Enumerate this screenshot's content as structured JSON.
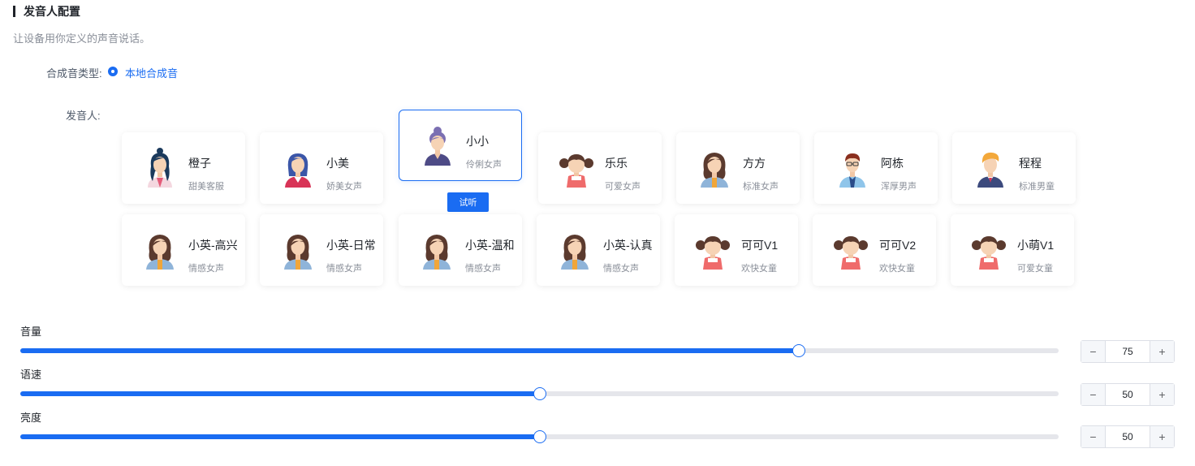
{
  "header": {
    "title": "发音人配置",
    "subtitle": "让设备用你定义的声音说话。"
  },
  "synth_type": {
    "label": "合成音类型:",
    "selected": "本地合成音"
  },
  "speaker": {
    "label": "发音人:",
    "selected": "小小",
    "listen_label": "试听"
  },
  "voices": [
    {
      "name": "橙子",
      "desc": "甜美客服",
      "avatar": "woman-bun-teal-avatar"
    },
    {
      "name": "小美",
      "desc": "娇美女声",
      "avatar": "woman-blue-hair-avatar"
    },
    {
      "name": "小小",
      "desc": "伶俐女声",
      "avatar": "woman-purple-bun-avatar"
    },
    {
      "name": "乐乐",
      "desc": "可爱女声",
      "avatar": "girl-pigtails-avatar"
    },
    {
      "name": "方方",
      "desc": "标准女声",
      "avatar": "woman-brown-hair-avatar"
    },
    {
      "name": "阿栋",
      "desc": "浑厚男声",
      "avatar": "man-glasses-avatar"
    },
    {
      "name": "程程",
      "desc": "标准男童",
      "avatar": "boy-blonde-avatar"
    },
    {
      "name": "小英-高兴",
      "desc": "情感女声",
      "avatar": "woman-brown-hair-avatar"
    },
    {
      "name": "小英-日常",
      "desc": "情感女声",
      "avatar": "woman-brown-hair-avatar"
    },
    {
      "name": "小英-温和",
      "desc": "情感女声",
      "avatar": "woman-brown-hair-avatar"
    },
    {
      "name": "小英-认真",
      "desc": "情感女声",
      "avatar": "woman-brown-hair-avatar"
    },
    {
      "name": "可可V1",
      "desc": "欢快女童",
      "avatar": "girl-pigtails-avatar"
    },
    {
      "name": "可可V2",
      "desc": "欢快女童",
      "avatar": "girl-pigtails-avatar"
    },
    {
      "name": "小萌V1",
      "desc": "可爱女童",
      "avatar": "girl-pigtails-avatar"
    }
  ],
  "sliders": {
    "volume": {
      "label": "音量",
      "value": 75,
      "min": 0,
      "max": 100
    },
    "speed": {
      "label": "语速",
      "value": 50,
      "min": 0,
      "max": 100
    },
    "brightness": {
      "label": "亮度",
      "value": 50,
      "min": 0,
      "max": 100
    }
  },
  "stepper": {
    "minus": "−",
    "plus": "+"
  },
  "colors": {
    "accent": "#1a6cf2",
    "track": "#e5e6eb",
    "muted": "#8a8f99"
  }
}
